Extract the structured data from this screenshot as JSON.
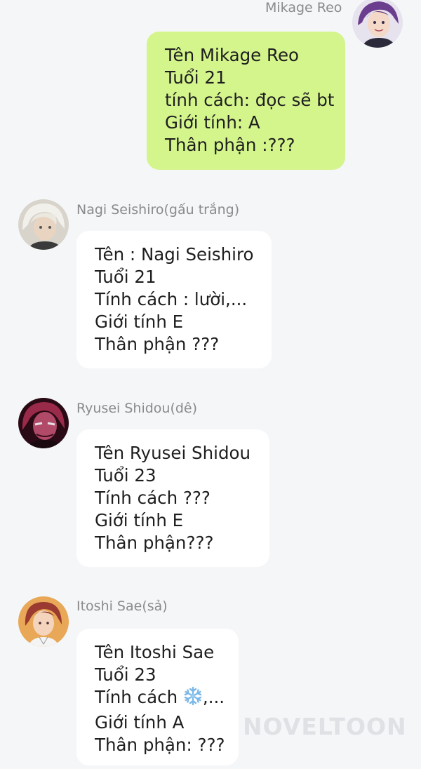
{
  "messages": [
    {
      "sender": "Mikage Reo",
      "avatar_icon": "purple-hair-avatar",
      "direction": "outgoing",
      "lines": [
        "Tên Mikage Reo",
        "Tuổi 21",
        "tính cách: đọc sẽ bt",
        "Giới tính: A",
        "Thân phận :???"
      ]
    },
    {
      "sender": "Nagi Seishiro(gấu trắng)",
      "avatar_icon": "white-hair-avatar",
      "direction": "incoming",
      "lines": [
        "Tên : Nagi Seishiro",
        "Tuổi 21",
        "Tính cách : lười,...",
        "Giới tính E",
        "Thân phận ???"
      ]
    },
    {
      "sender": "Ryusei Shidou(dê)",
      "avatar_icon": "pink-hair-avatar",
      "direction": "incoming",
      "lines": [
        "Tên Ryusei Shidou",
        "Tuổi 23",
        "Tính cách ???",
        "Giới tính E",
        "Thân phận???"
      ]
    },
    {
      "sender": "Itoshi Sae(sả)",
      "avatar_icon": "red-hair-avatar",
      "direction": "incoming",
      "lines": [
        "Tên Itoshi Sae",
        "Tuổi 23",
        "Tính cách",
        ",...",
        "Giới tính A",
        "Thân phận: ???"
      ]
    }
  ],
  "emoji": "snowflake-icon",
  "watermark": "NOVELTOON",
  "colors": {
    "outgoing_bubble": "#d4f48c",
    "incoming_bubble": "#ffffff",
    "background": "#f5f6f8",
    "sender_text": "#8a8a8a"
  }
}
